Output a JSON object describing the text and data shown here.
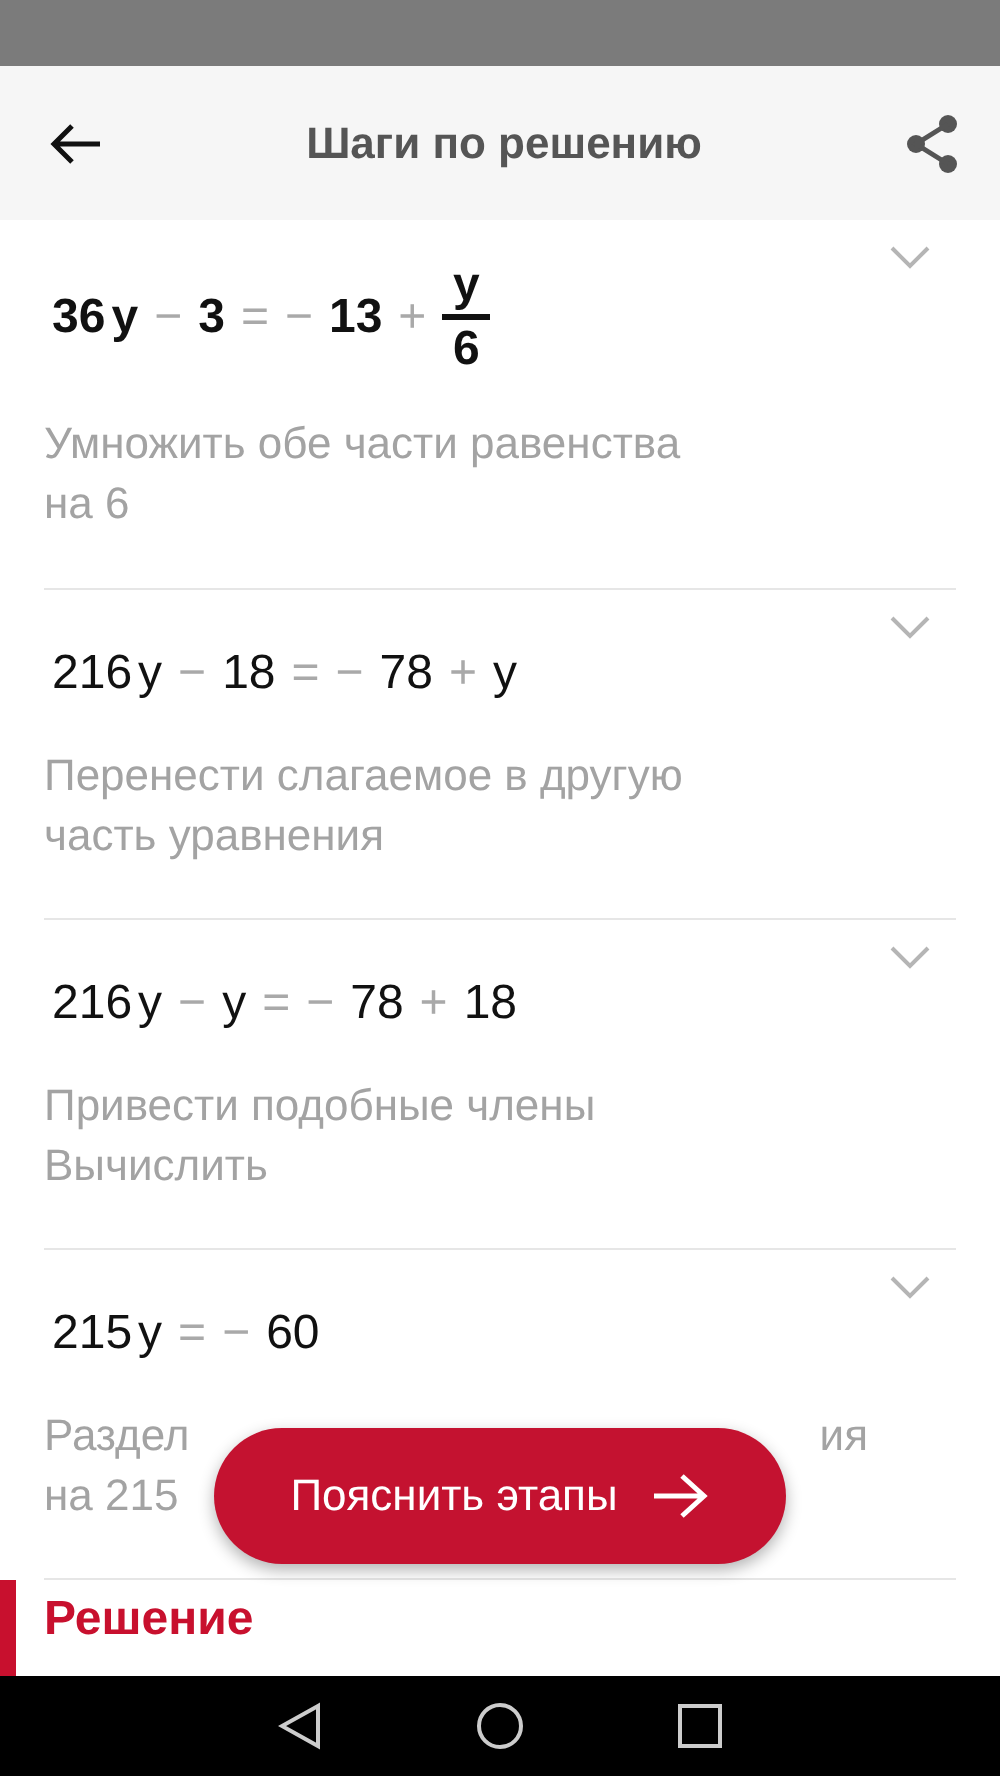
{
  "header": {
    "title": "Шаги по решению"
  },
  "steps": [
    {
      "bold": true,
      "expanded": false,
      "equation": [
        {
          "kind": "term",
          "t": "36"
        },
        {
          "kind": "var",
          "t": "y"
        },
        {
          "kind": "op",
          "t": "−"
        },
        {
          "kind": "term",
          "t": "3"
        },
        {
          "kind": "op",
          "t": "="
        },
        {
          "kind": "op",
          "t": "−"
        },
        {
          "kind": "term",
          "t": "13"
        },
        {
          "kind": "op",
          "t": "+"
        },
        {
          "kind": "frac",
          "num": "y",
          "den": "6"
        }
      ],
      "description": [
        [
          "Умножить обе части равенства"
        ],
        [
          "на 6"
        ]
      ]
    },
    {
      "bold": false,
      "expanded": false,
      "equation": [
        {
          "kind": "term",
          "t": "216"
        },
        {
          "kind": "var",
          "t": "y"
        },
        {
          "kind": "op",
          "t": "−"
        },
        {
          "kind": "term",
          "t": "18"
        },
        {
          "kind": "op",
          "t": "="
        },
        {
          "kind": "op",
          "t": "−"
        },
        {
          "kind": "term",
          "t": "78"
        },
        {
          "kind": "op",
          "t": "+"
        },
        {
          "kind": "term",
          "t": "y"
        }
      ],
      "description": [
        [
          "Перенести слагаемое в другую"
        ],
        [
          "часть уравнения"
        ]
      ]
    },
    {
      "bold": false,
      "expanded": false,
      "equation": [
        {
          "kind": "term",
          "t": "216"
        },
        {
          "kind": "var",
          "t": "y"
        },
        {
          "kind": "op",
          "t": "−"
        },
        {
          "kind": "term",
          "t": "y"
        },
        {
          "kind": "op",
          "t": "="
        },
        {
          "kind": "op",
          "t": "−"
        },
        {
          "kind": "term",
          "t": "78"
        },
        {
          "kind": "op",
          "t": "+"
        },
        {
          "kind": "term",
          "t": "18"
        }
      ],
      "description": [
        [
          "Привести подобные члены"
        ],
        [
          "Вычислить"
        ]
      ]
    },
    {
      "bold": false,
      "expanded": false,
      "equation": [
        {
          "kind": "term",
          "t": "215"
        },
        {
          "kind": "var",
          "t": "y"
        },
        {
          "kind": "op",
          "t": "="
        },
        {
          "kind": "op",
          "t": "−"
        },
        {
          "kind": "term",
          "t": "60"
        }
      ],
      "description": [
        [
          "Раздел",
          "ия"
        ],
        [
          "на 215"
        ]
      ]
    }
  ],
  "section": {
    "title": "Решение"
  },
  "explain_button": {
    "label": "Пояснить этапы"
  }
}
